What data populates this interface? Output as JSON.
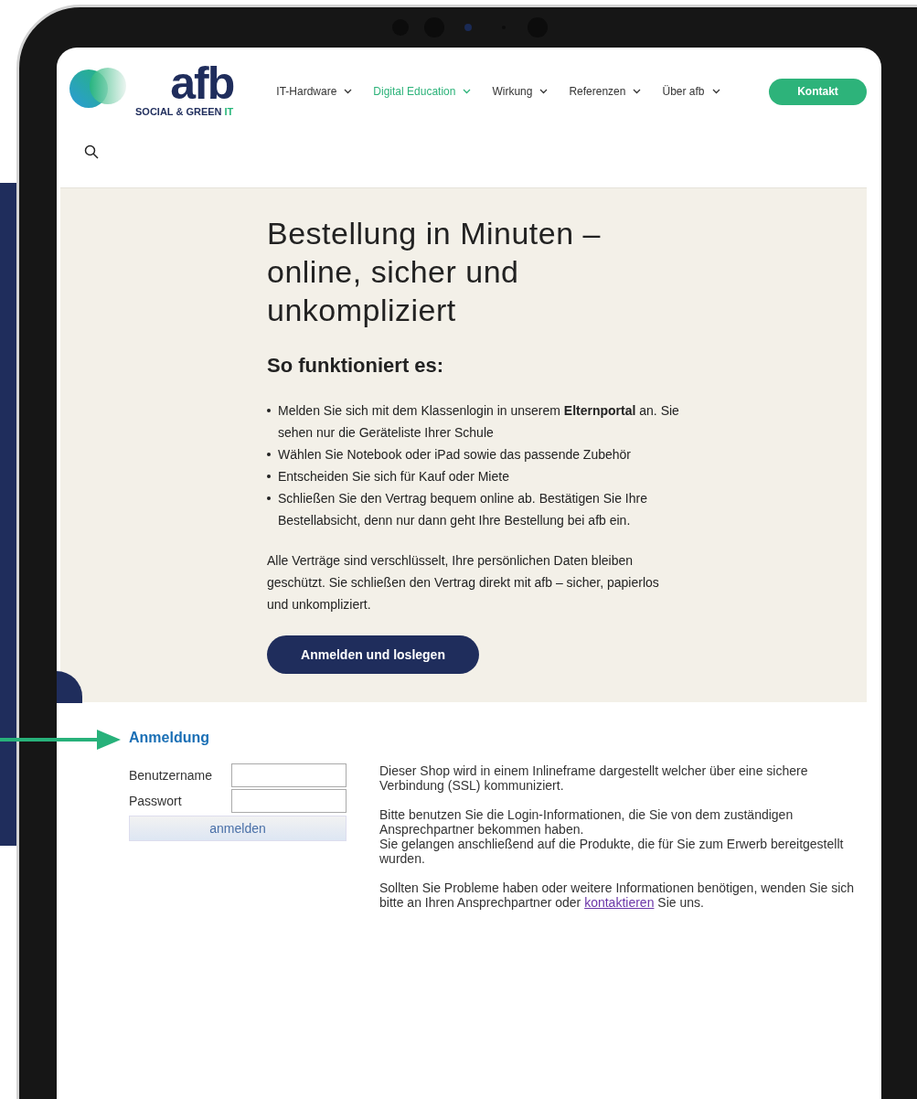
{
  "logo": {
    "wordmark": "afb",
    "tagline": "SOCIAL & GREEN",
    "tagline_accent": "IT"
  },
  "nav": [
    {
      "label": "IT-Hardware",
      "selected": false
    },
    {
      "label": "Digital Education",
      "selected": true
    },
    {
      "label": "Wirkung",
      "selected": false
    },
    {
      "label": "Referenzen",
      "selected": false
    },
    {
      "label": "Über afb",
      "selected": false
    }
  ],
  "contact_button": "Kontakt",
  "hero": {
    "title": "Bestellung in Minuten – online, sicher und unkompliziert",
    "subtitle": "So funktioniert es:",
    "bullets": [
      "Melden Sie sich mit dem Klassenlogin in unserem **Elternportal** an. Sie sehen nur die Geräteliste Ihrer Schule",
      "Wählen Sie Notebook oder iPad sowie das passende Zubehör",
      "Entscheiden Sie sich für Kauf oder Miete",
      "Schließen Sie den Vertrag bequem online ab. Bestätigen Sie Ihre Bestellabsicht, denn nur dann geht Ihre Bestellung bei afb ein."
    ],
    "note": "Alle Verträge sind verschlüsselt, Ihre persönlichen Daten bleiben geschützt. Sie schließen den Vertrag direkt mit afb – sicher, papierlos und unkompliziert.",
    "button": "Anmelden und loslegen"
  },
  "login": {
    "title": "Anmeldung",
    "fields": [
      {
        "label": "Benutzername"
      },
      {
        "label": "Passwort"
      }
    ],
    "button": "anmelden",
    "info": [
      {
        "lines": [
          "Dieser Shop wird in einem Inlineframe dargestellt welcher über eine sichere Verbindung (SSL) kommuniziert."
        ]
      },
      {
        "lines": [
          "Bitte benutzen Sie die Login-Informationen, die Sie von dem zuständigen Ansprechpartner bekommen haben.",
          "Sie gelangen anschließend auf die Produkte, die für Sie zum Erwerb bereitgestellt wurden."
        ]
      },
      {
        "lines": [
          "Sollten Sie Probleme haben oder weitere Informationen benötigen, wenden Sie sich bitte an Ihren Ansprechpartner oder"
        ],
        "link": "kontaktieren",
        "after": "Sie uns."
      }
    ]
  }
}
